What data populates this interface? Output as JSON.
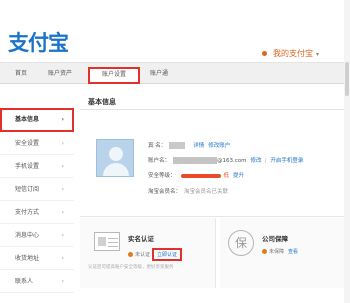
{
  "header": {
    "logo": "支付宝",
    "my_alipay": "我的支付宝"
  },
  "nav": {
    "tabs": [
      {
        "label": "首页"
      },
      {
        "label": "账户资产"
      },
      {
        "label": "账户设置"
      },
      {
        "label": "账户通"
      }
    ]
  },
  "sidebar": {
    "items": [
      {
        "label": "基本信息",
        "active": true
      },
      {
        "label": "安全设置"
      },
      {
        "label": "手机设置"
      },
      {
        "label": "短信订阅"
      },
      {
        "label": "支付方式"
      },
      {
        "label": "消息中心"
      },
      {
        "label": "收货地址"
      },
      {
        "label": "联系人"
      }
    ]
  },
  "main": {
    "title": "基本信息",
    "rows": {
      "name_label": "真 名：",
      "name_link1": "详情",
      "name_link2": "修改账户",
      "account_label": "账户名：",
      "account_value": "@163.com",
      "account_link1": "修改",
      "account_link2": "开启手机登录",
      "security_label": "安全等级：",
      "security_text": "低",
      "security_link": "提升",
      "taobao_label": "淘宝会员名：",
      "taobao_value": "淘宝会员名已关联"
    },
    "cards": {
      "realname": {
        "title": "实名认证",
        "status": "未认证",
        "action": "立即认证",
        "note": "认证后可提高账户安全等级，更好享受服务"
      },
      "insurance": {
        "title": "公司保障",
        "status": "未保障",
        "action": "查看"
      }
    }
  }
}
